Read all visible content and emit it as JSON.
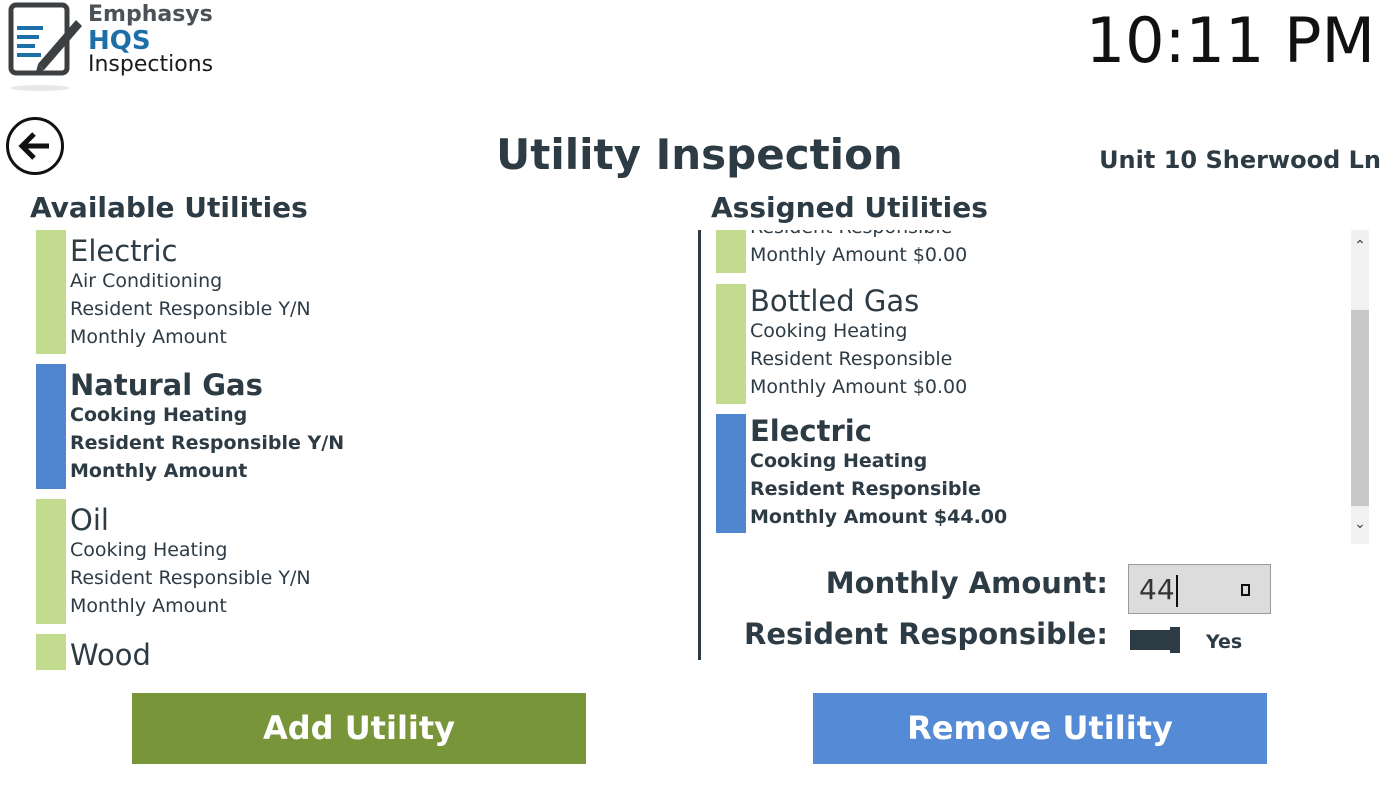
{
  "app": {
    "logo": {
      "line1": "Emphasys",
      "line2": "HQS",
      "line3": "Inspections"
    },
    "clock": "10:11 PM",
    "title": "Utility Inspection",
    "unit": "Unit 10 Sherwood Ln"
  },
  "available": {
    "heading": "Available Utilities",
    "items": [
      {
        "name": "Electric",
        "usage": "Air Conditioning",
        "responsible": "Resident Responsible  Y/N",
        "amount": "Monthly Amount",
        "selected": false
      },
      {
        "name": "Natural Gas",
        "usage": "Cooking Heating",
        "responsible": "Resident Responsible  Y/N",
        "amount": "Monthly Amount",
        "selected": true
      },
      {
        "name": "Oil",
        "usage": "Cooking Heating",
        "responsible": "Resident Responsible  Y/N",
        "amount": "Monthly Amount",
        "selected": false
      },
      {
        "name": "Wood",
        "selected": false
      }
    ]
  },
  "assigned": {
    "heading": "Assigned Utilities",
    "items": [
      {
        "responsible": "Resident Responsible",
        "amount": "Monthly Amount  $0.00",
        "selected": false
      },
      {
        "name": "Bottled Gas",
        "usage": "Cooking Heating",
        "responsible": "Resident Responsible",
        "amount": "Monthly Amount  $0.00",
        "selected": false
      },
      {
        "name": "Electric",
        "usage": "Cooking Heating",
        "responsible": "Resident Responsible",
        "amount": "Monthly Amount  $44.00",
        "selected": true
      }
    ]
  },
  "editor": {
    "amount_label": "Monthly Amount:",
    "amount_value": "44",
    "responsible_label": "Resident Responsible:",
    "responsible_on": true,
    "responsible_text": "Yes"
  },
  "buttons": {
    "add": "Add Utility",
    "remove": "Remove Utility"
  },
  "colors": {
    "item_bar": "#c3db8e",
    "item_bar_selected": "#4f86cf",
    "add_button": "#78953a",
    "remove_button": "#548ad6",
    "text": "#2d3b45"
  }
}
